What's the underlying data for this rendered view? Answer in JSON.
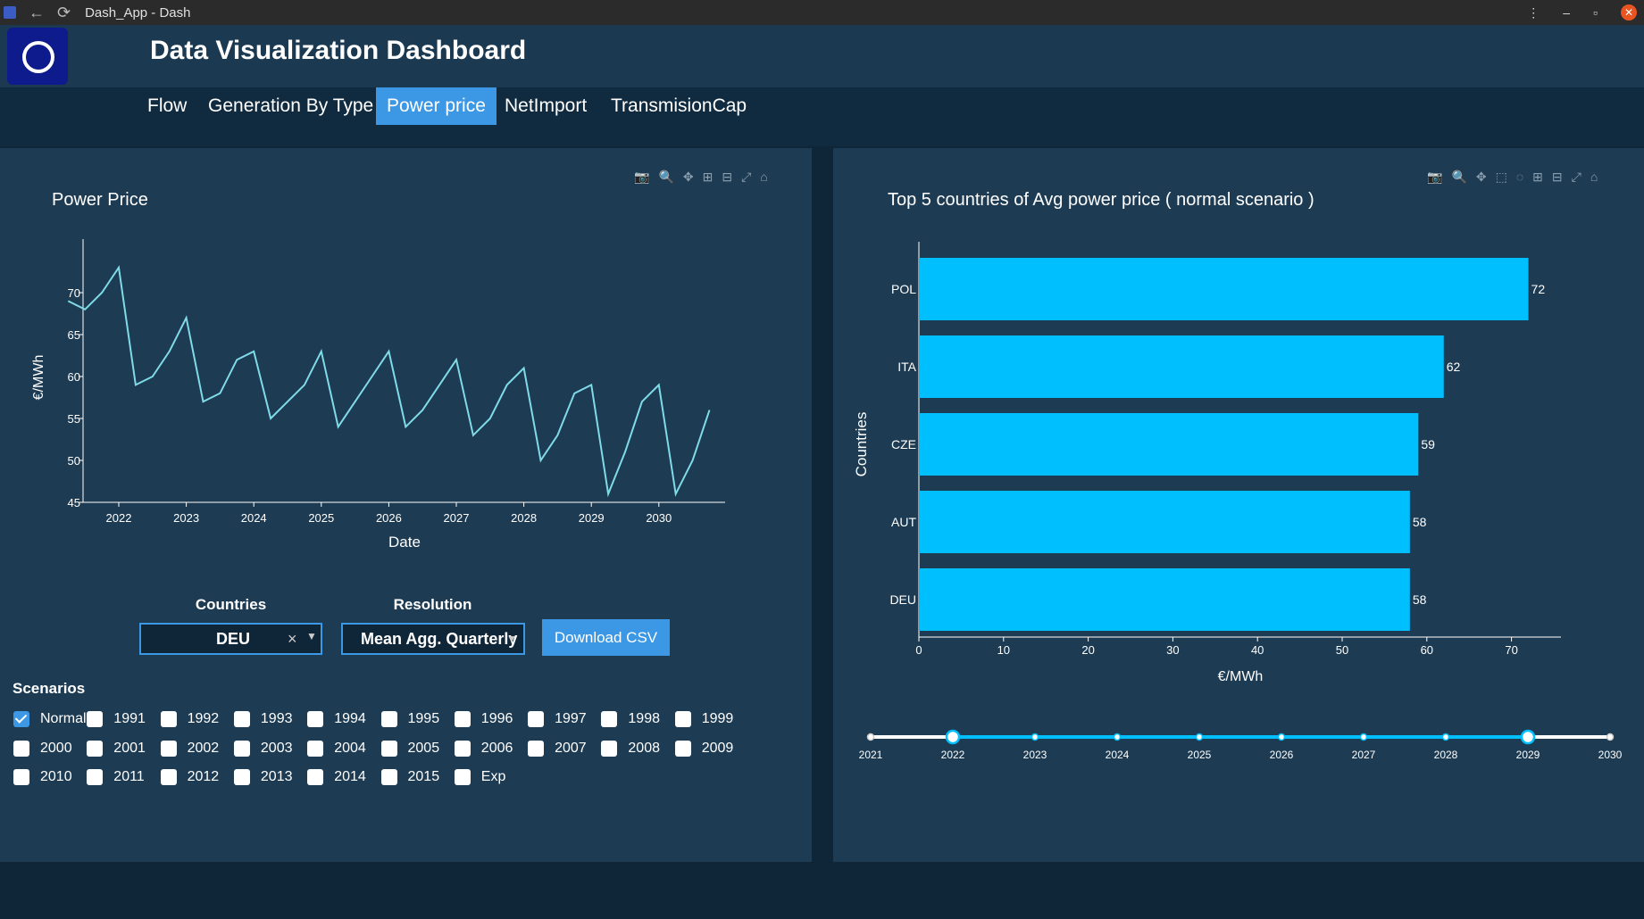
{
  "window": {
    "title": "Dash_App - Dash"
  },
  "header": {
    "title": "Data Visualization Dashboard"
  },
  "tabs": [
    {
      "label": "Flow",
      "active": false
    },
    {
      "label": "Generation By Type",
      "active": false
    },
    {
      "label": "Power price",
      "active": true
    },
    {
      "label": "NetImport",
      "active": false
    },
    {
      "label": "TransmisionCap",
      "active": false
    }
  ],
  "line_chart": {
    "title": "Power Price",
    "xlabel": "Date",
    "ylabel": "€/MWh",
    "x_ticks": [
      "2022",
      "2023",
      "2024",
      "2025",
      "2026",
      "2027",
      "2028",
      "2029",
      "2030"
    ],
    "y_ticks": [
      "45",
      "50",
      "55",
      "60",
      "65",
      "70"
    ],
    "color": "#7fdbe8"
  },
  "bar_chart": {
    "title": "Top 5 countries of Avg power price ( normal scenario )",
    "xlabel": "€/MWh",
    "ylabel": "Countries",
    "x_ticks": [
      "0",
      "10",
      "20",
      "30",
      "40",
      "50",
      "60",
      "70"
    ],
    "color": "#00bfff"
  },
  "chart_data": [
    {
      "type": "line",
      "title": "Power Price",
      "xlabel": "Date",
      "ylabel": "€/MWh",
      "ylim": [
        45,
        75
      ],
      "x": [
        "2021-Q2",
        "2021-Q3",
        "2021-Q4",
        "2022-Q1",
        "2022-Q2",
        "2022-Q3",
        "2022-Q4",
        "2023-Q1",
        "2023-Q2",
        "2023-Q3",
        "2023-Q4",
        "2024-Q1",
        "2024-Q2",
        "2024-Q3",
        "2024-Q4",
        "2025-Q1",
        "2025-Q2",
        "2025-Q3",
        "2025-Q4",
        "2026-Q1",
        "2026-Q2",
        "2026-Q3",
        "2026-Q4",
        "2027-Q1",
        "2027-Q2",
        "2027-Q3",
        "2027-Q4",
        "2028-Q1",
        "2028-Q2",
        "2028-Q3",
        "2028-Q4",
        "2029-Q1",
        "2029-Q2",
        "2029-Q3",
        "2029-Q4",
        "2030-Q1",
        "2030-Q2",
        "2030-Q3",
        "2030-Q4"
      ],
      "values": [
        69,
        68,
        70,
        73,
        59,
        60,
        63,
        67,
        57,
        58,
        62,
        63,
        55,
        57,
        59,
        63,
        54,
        57,
        60,
        63,
        54,
        56,
        59,
        62,
        53,
        55,
        59,
        61,
        50,
        53,
        58,
        59,
        46,
        51,
        57,
        59,
        46,
        50,
        56
      ]
    },
    {
      "type": "bar",
      "orientation": "horizontal",
      "title": "Top 5 countries of Avg power price ( normal scenario )",
      "xlabel": "€/MWh",
      "ylabel": "Countries",
      "categories": [
        "POL",
        "ITA",
        "CZE",
        "AUT",
        "DEU"
      ],
      "values": [
        72,
        62,
        59,
        58,
        58
      ],
      "xlim": [
        0,
        76
      ]
    }
  ],
  "controls": {
    "countries_label": "Countries",
    "countries_value": "DEU",
    "clear_symbol": "×",
    "resolution_label": "Resolution",
    "resolution_value": "Mean Agg. Quarterly",
    "download_label": "Download CSV"
  },
  "scenarios": {
    "title": "Scenarios",
    "items": [
      {
        "label": "Normal",
        "checked": true
      },
      {
        "label": "1991",
        "checked": false
      },
      {
        "label": "1992",
        "checked": false
      },
      {
        "label": "1993",
        "checked": false
      },
      {
        "label": "1994",
        "checked": false
      },
      {
        "label": "1995",
        "checked": false
      },
      {
        "label": "1996",
        "checked": false
      },
      {
        "label": "1997",
        "checked": false
      },
      {
        "label": "1998",
        "checked": false
      },
      {
        "label": "1999",
        "checked": false
      },
      {
        "label": "2000",
        "checked": false
      },
      {
        "label": "2001",
        "checked": false
      },
      {
        "label": "2002",
        "checked": false
      },
      {
        "label": "2003",
        "checked": false
      },
      {
        "label": "2004",
        "checked": false
      },
      {
        "label": "2005",
        "checked": false
      },
      {
        "label": "2006",
        "checked": false
      },
      {
        "label": "2007",
        "checked": false
      },
      {
        "label": "2008",
        "checked": false
      },
      {
        "label": "2009",
        "checked": false
      },
      {
        "label": "2010",
        "checked": false
      },
      {
        "label": "2011",
        "checked": false
      },
      {
        "label": "2012",
        "checked": false
      },
      {
        "label": "2013",
        "checked": false
      },
      {
        "label": "2014",
        "checked": false
      },
      {
        "label": "2015",
        "checked": false
      },
      {
        "label": "Exp",
        "checked": false
      }
    ]
  },
  "slider": {
    "marks": [
      "2021",
      "2022",
      "2023",
      "2024",
      "2025",
      "2026",
      "2027",
      "2028",
      "2029",
      "2030"
    ],
    "range": [
      "2022",
      "2029"
    ]
  },
  "icons": [
    "camera-icon",
    "zoom-icon",
    "pan-icon",
    "zoom-in-icon",
    "zoom-out-icon",
    "autoscale-icon",
    "reset-axes-icon",
    "box-select-icon",
    "lasso-icon"
  ]
}
